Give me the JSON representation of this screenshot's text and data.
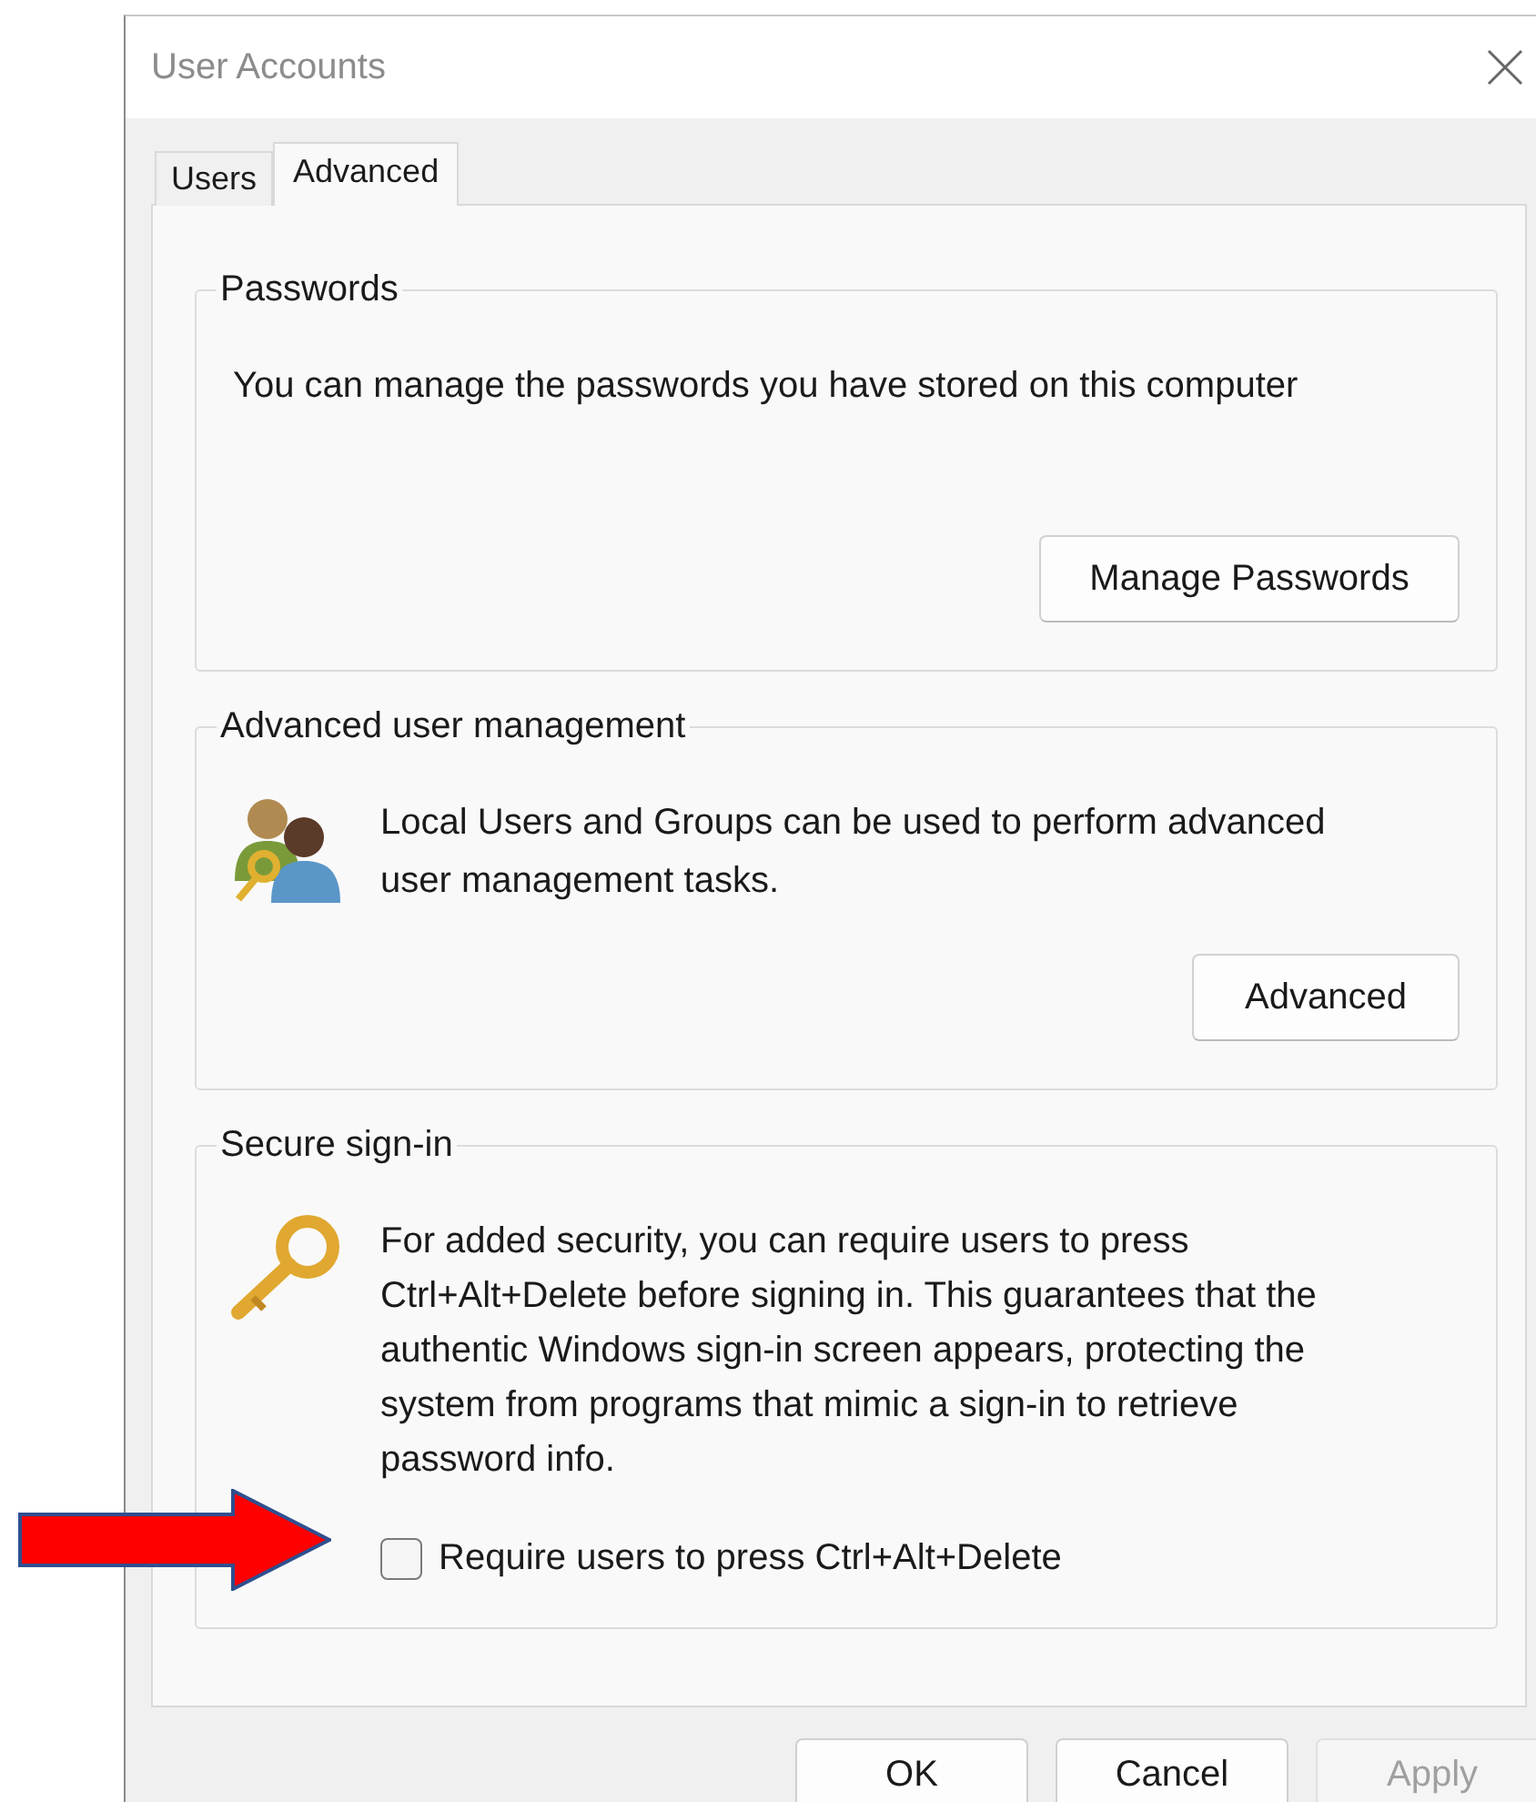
{
  "window": {
    "title": "User Accounts"
  },
  "tabs": [
    {
      "label": "Users",
      "selected": false
    },
    {
      "label": "Advanced",
      "selected": true
    }
  ],
  "groups": [
    {
      "title": "Passwords",
      "kind": "plain",
      "text": "You can manage the passwords you have stored on this computer",
      "button": "Manage Passwords"
    },
    {
      "title": "Advanced user management",
      "kind": "users",
      "text": "Local Users and Groups can be used to perform advanced user management tasks.",
      "button": "Advanced"
    },
    {
      "title": "Secure sign-in",
      "kind": "security",
      "text": "For added security, you can require users to press Ctrl+Alt+Delete before signing in. This guarantees that the authentic Windows sign-in screen appears, protecting the system from programs that mimic a sign-in to retrieve password info.",
      "checkbox": {
        "label": "Require users to press Ctrl+Alt+Delete",
        "checked": false
      }
    }
  ],
  "buttons": [
    {
      "label": "OK",
      "disabled": false
    },
    {
      "label": "Cancel",
      "disabled": false
    },
    {
      "label": "Apply",
      "disabled": true
    }
  ]
}
